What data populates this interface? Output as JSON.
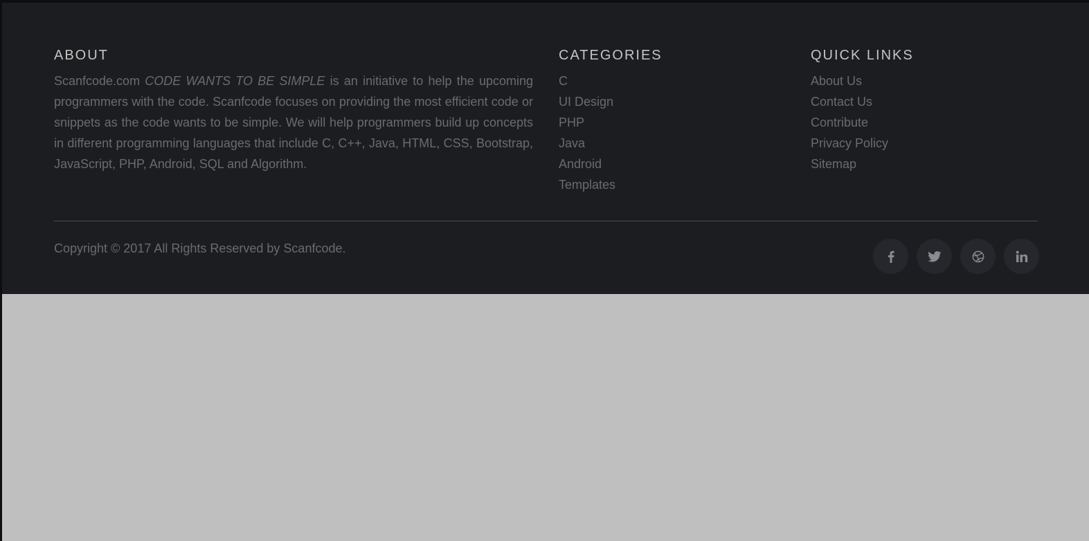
{
  "about": {
    "heading": "ABOUT",
    "brand": "Scanfcode.com",
    "tagline": "CODE WANTS TO BE SIMPLE",
    "description": "is an initiative to help the upcoming programmers with the code. Scanfcode focuses on providing the most efficient code or snippets as the code wants to be simple. We will help programmers build up concepts in different programming languages that include C, C++, Java, HTML, CSS, Bootstrap, JavaScript, PHP, Android, SQL and Algorithm."
  },
  "categories": {
    "heading": "CATEGORIES",
    "items": [
      "C",
      "UI Design",
      "PHP",
      "Java",
      "Android",
      "Templates"
    ]
  },
  "quick_links": {
    "heading": "QUICK LINKS",
    "items": [
      "About Us",
      "Contact Us",
      "Contribute",
      "Privacy Policy",
      "Sitemap"
    ]
  },
  "copyright": "Copyright © 2017 All Rights Reserved by Scanfcode.",
  "socials": [
    {
      "name": "facebook-icon",
      "glyph": "f"
    },
    {
      "name": "twitter-icon",
      "glyph": "twitter"
    },
    {
      "name": "dribbble-icon",
      "glyph": "dribbble"
    },
    {
      "name": "linkedin-icon",
      "glyph": "in"
    }
  ],
  "colors": {
    "footer_bg": "#1c1d21",
    "page_bg": "#bfbfbf",
    "heading": "#c4c4c4",
    "text": "#6a6b70",
    "social_bg": "#26272c"
  }
}
